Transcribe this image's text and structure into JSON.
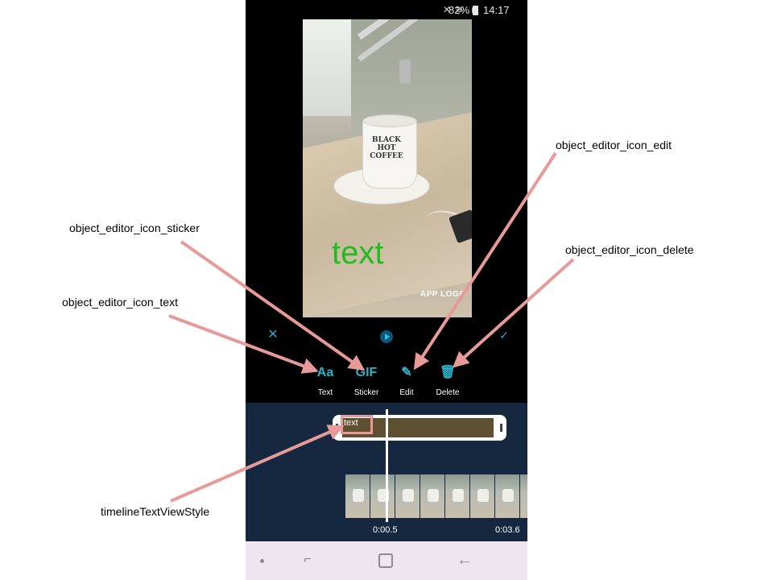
{
  "status_bar": {
    "battery": "82%",
    "time": "14:17"
  },
  "preview": {
    "overlay_text": "text",
    "logo_text": "APP LOGO",
    "cup_print": "BLACK HOT COFFEE"
  },
  "controls": {
    "close_icon": "close-icon",
    "play_icon": "play-icon",
    "confirm_icon": "check-icon"
  },
  "tools": [
    {
      "icon_text": "Aa",
      "label": "Text"
    },
    {
      "icon_text": "GIF",
      "label": "Sticker"
    },
    {
      "icon_text": "✎",
      "label": "Edit"
    },
    {
      "icon_text": "🗑",
      "label": "Delete"
    }
  ],
  "timeline": {
    "text_track_label": "text",
    "current_time": "0:00.5",
    "total_time": "0:03.6"
  },
  "callouts": {
    "sticker": "object_editor_icon_sticker",
    "text": "object_editor_icon_text",
    "edit": "object_editor_icon_edit",
    "delete": "object_editor_icon_delete",
    "timeline": "timelineTextViewStyle"
  },
  "colors": {
    "accent": "#2ab2c9",
    "timeline_bg": "#162840",
    "callout_arrow": "#e79a98",
    "overlay_text": "#22bb22",
    "text_track_fill": "#5e4f30"
  }
}
